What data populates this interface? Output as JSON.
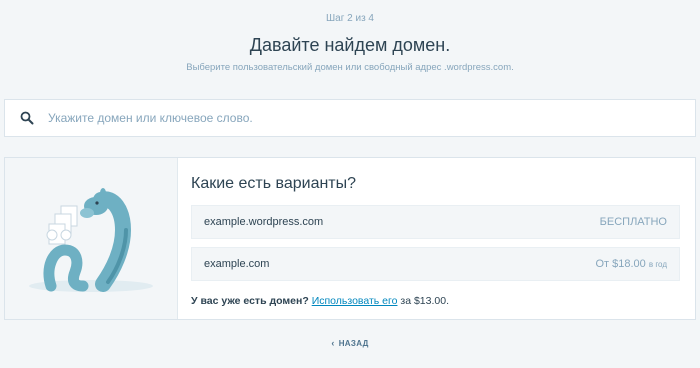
{
  "header": {
    "step": "Шаг 2 из 4",
    "title": "Давайте найдем домен.",
    "subtitle": "Выберите пользовательский домен или свободный адрес .wordpress.com."
  },
  "search": {
    "placeholder": "Укажите домен или ключевое слово.",
    "value": "",
    "icon": "search-icon"
  },
  "suggestions": {
    "heading": "Какие есть варианты?",
    "items": [
      {
        "domain": "example.wordpress.com",
        "price": "БЕСПЛАТНО",
        "period": ""
      },
      {
        "domain": "example.com",
        "price": "От $18.00",
        "period": "в год"
      }
    ]
  },
  "have_domain": {
    "question": "У вас уже есть домен?",
    "link": "Использовать его",
    "suffix": "за $13.00."
  },
  "footer": {
    "back_label": "НАЗАД",
    "back_icon": "chevron-left-icon"
  },
  "colors": {
    "background": "#f3f6f8",
    "accent_link": "#0087be",
    "muted": "#87a6bc",
    "text": "#2e4453",
    "illustration": "#6eb0c3"
  }
}
